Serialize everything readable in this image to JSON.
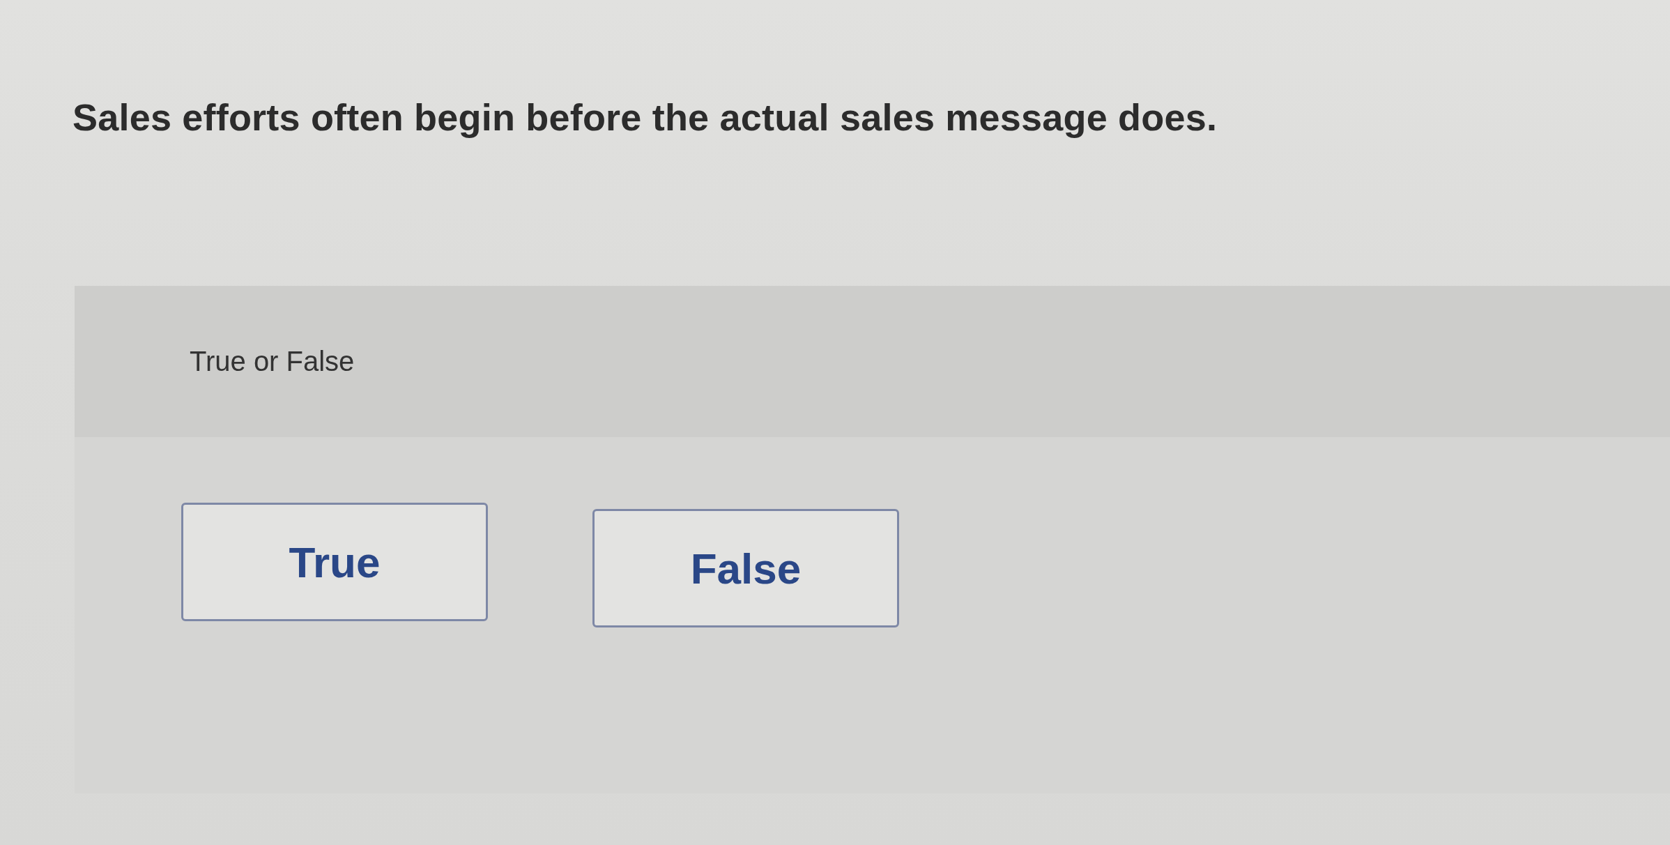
{
  "question": "Sales efforts often begin before the actual sales message does.",
  "answer_panel": {
    "instruction": "True or False",
    "options": [
      {
        "label": "True",
        "selected": false
      },
      {
        "label": "False",
        "selected": false
      }
    ]
  }
}
